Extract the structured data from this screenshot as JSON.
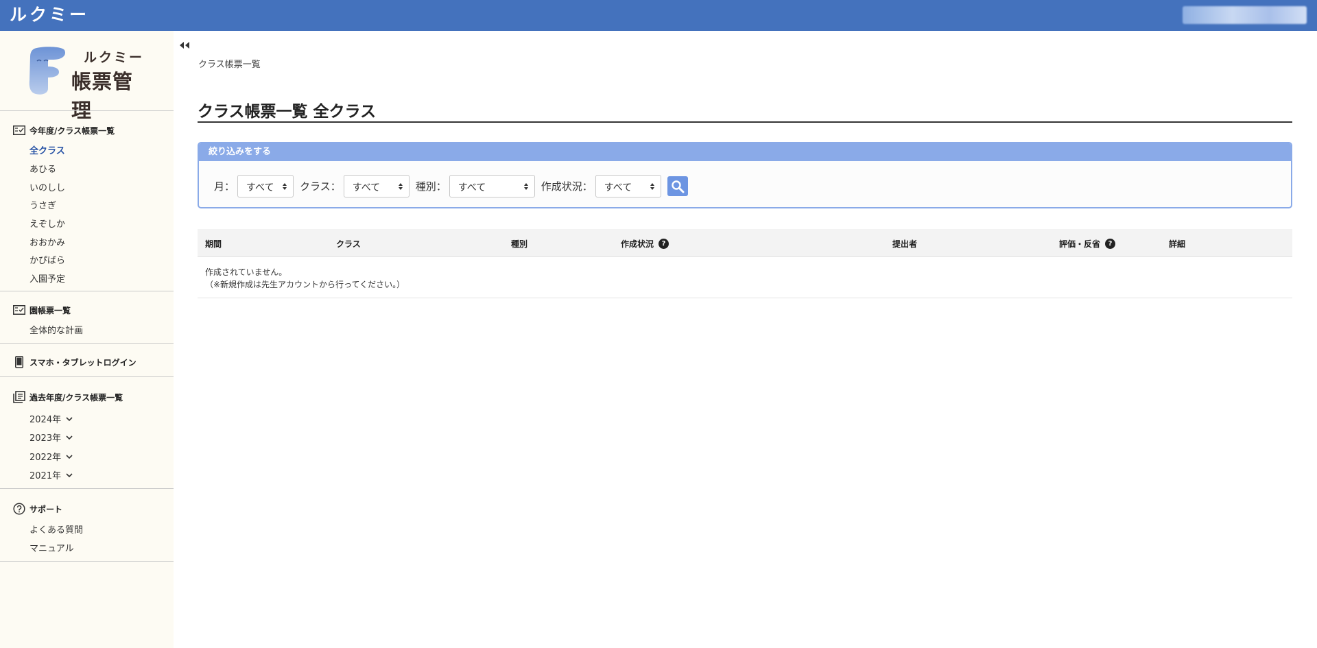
{
  "header": {
    "brand": "ルクミー"
  },
  "logo": {
    "small": "ルクミー",
    "big": "帳票管理"
  },
  "sidebar": {
    "current_year": {
      "title": "今年度/クラス帳票一覧",
      "items": [
        "全クラス",
        "あひる",
        "いのしし",
        "うさぎ",
        "えぞしか",
        "おおかみ",
        "かぴばら",
        "入園予定"
      ]
    },
    "school": {
      "title": "園帳票一覧",
      "items": [
        "全体的な計画"
      ]
    },
    "mobile": {
      "title": "スマホ・タブレットログイン"
    },
    "past_years": {
      "title": "過去年度/クラス帳票一覧",
      "items": [
        "2024年",
        "2023年",
        "2022年",
        "2021年"
      ]
    },
    "support": {
      "title": "サポート",
      "items": [
        "よくある質問",
        "マニュアル"
      ]
    }
  },
  "breadcrumb": "クラス帳票一覧",
  "page_title": "クラス帳票一覧 全クラス",
  "filter": {
    "heading": "絞り込みをする",
    "month_label": "月：",
    "month_value": "すべて",
    "class_label": "クラス：",
    "class_value": "すべて",
    "type_label": "種別：",
    "type_value": "すべて",
    "status_label": "作成状況：",
    "status_value": "すべて"
  },
  "table": {
    "columns": [
      "期間",
      "クラス",
      "種別",
      "作成状況",
      "提出者",
      "評価・反省",
      "詳細"
    ],
    "empty_line1": "作成されていません。",
    "empty_line2": "（※新規作成は先生アカウントから行ってください。）"
  },
  "colors": {
    "header_bg": "#4472bd",
    "filter_accent": "#8aaae8",
    "active_nav": "#2450a4",
    "sidebar_bg": "#fdfbf3"
  }
}
